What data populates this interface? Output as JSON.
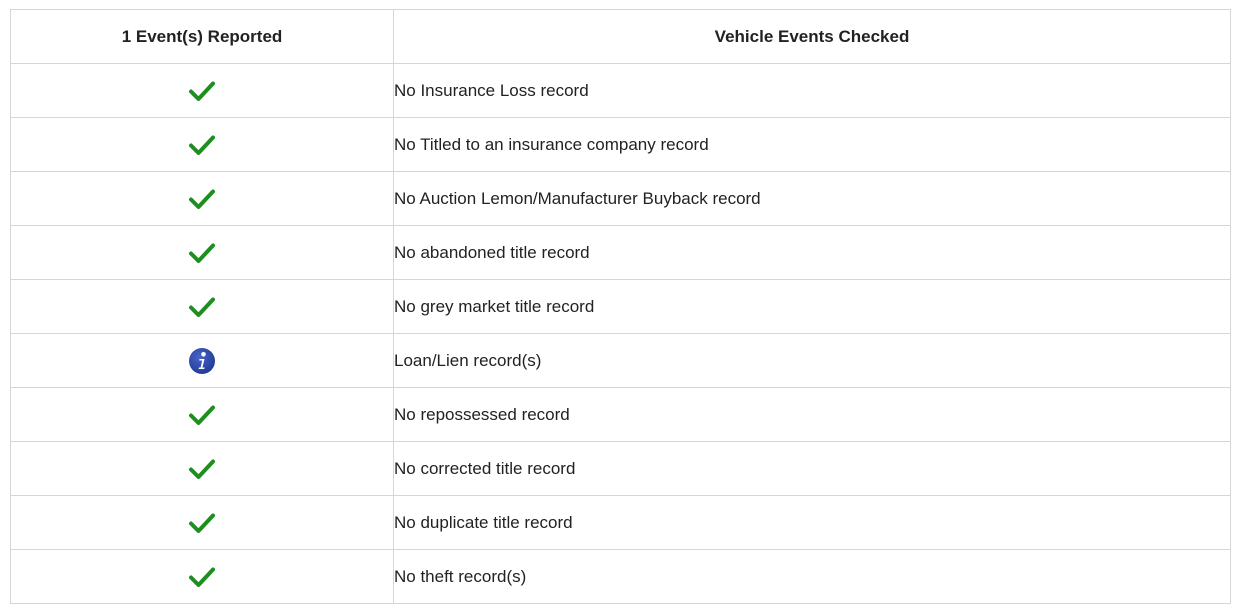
{
  "table": {
    "headers": {
      "reported": "1 Event(s) Reported",
      "checked": "Vehicle Events Checked"
    },
    "colors": {
      "check": "#1e8f1e",
      "info": "#1f3a93"
    },
    "rows": [
      {
        "status_icon": "check-icon",
        "label": "No Insurance Loss record"
      },
      {
        "status_icon": "check-icon",
        "label": "No Titled to an insurance company record"
      },
      {
        "status_icon": "check-icon",
        "label": "No Auction Lemon/Manufacturer Buyback record"
      },
      {
        "status_icon": "check-icon",
        "label": "No abandoned title record"
      },
      {
        "status_icon": "check-icon",
        "label": "No grey market title record"
      },
      {
        "status_icon": "info-icon",
        "label": "Loan/Lien record(s)"
      },
      {
        "status_icon": "check-icon",
        "label": "No repossessed record"
      },
      {
        "status_icon": "check-icon",
        "label": "No corrected title record"
      },
      {
        "status_icon": "check-icon",
        "label": "No duplicate title record"
      },
      {
        "status_icon": "check-icon",
        "label": "No theft record(s)"
      }
    ]
  }
}
